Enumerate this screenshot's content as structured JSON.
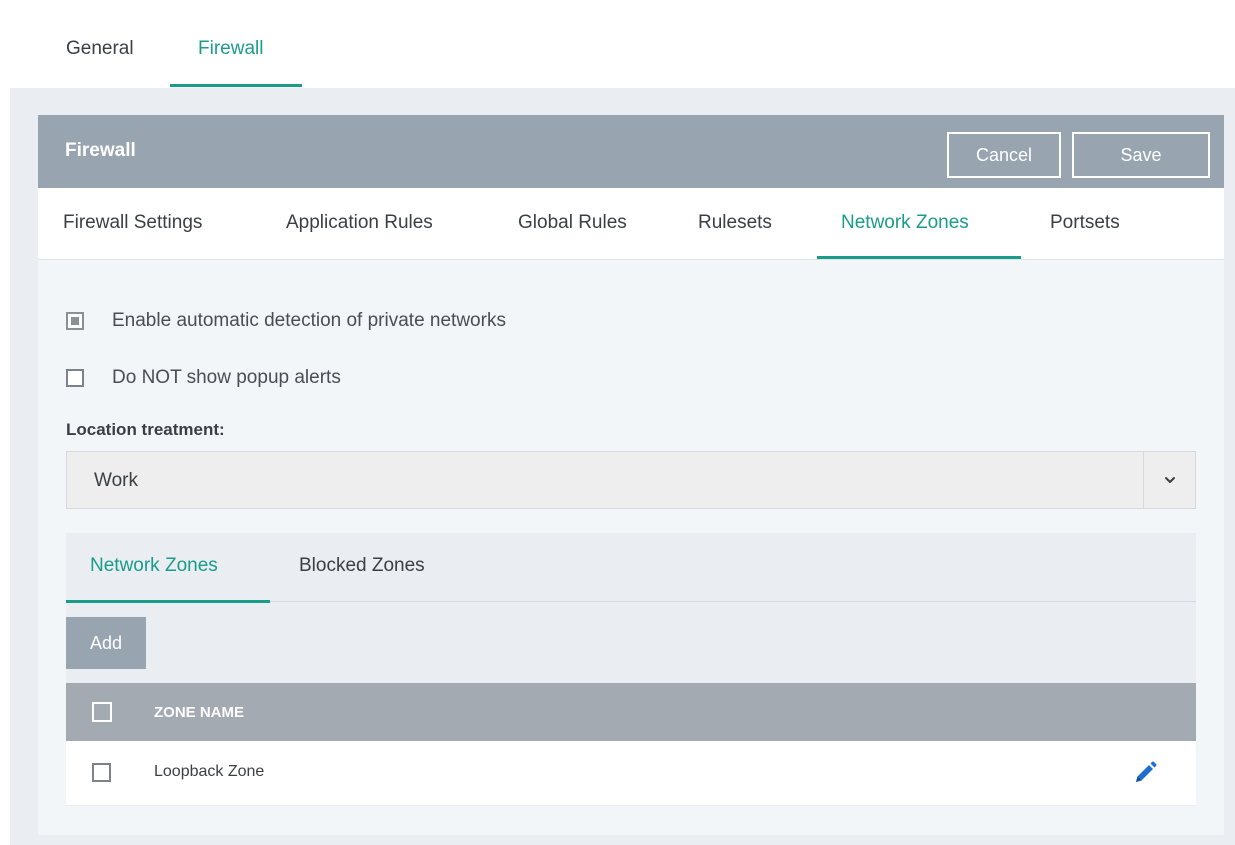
{
  "top_tabs": [
    {
      "label": "General",
      "active": false
    },
    {
      "label": "Firewall",
      "active": true
    }
  ],
  "panel": {
    "title": "Firewall",
    "cancel_label": "Cancel",
    "save_label": "Save"
  },
  "sub_tabs": [
    {
      "label": "Firewall Settings",
      "active": false
    },
    {
      "label": "Application Rules",
      "active": false
    },
    {
      "label": "Global Rules",
      "active": false
    },
    {
      "label": "Rulesets",
      "active": false
    },
    {
      "label": "Network Zones",
      "active": true
    },
    {
      "label": "Portsets",
      "active": false
    }
  ],
  "options": {
    "auto_detect": {
      "label": "Enable automatic detection of private networks",
      "checked": true
    },
    "no_popup": {
      "label": "Do NOT show popup alerts",
      "checked": false
    }
  },
  "location": {
    "label": "Location treatment:",
    "value": "Work",
    "arrow_icon": "chevron-down-icon"
  },
  "zones": {
    "tabs": [
      {
        "label": "Network Zones",
        "active": true
      },
      {
        "label": "Blocked Zones",
        "active": false
      }
    ],
    "add_label": "Add",
    "column_header": "ZONE NAME",
    "rows": [
      {
        "name": "Loopback Zone",
        "action_icon": "pencil-icon"
      }
    ]
  },
  "colors": {
    "accent": "#1a9c8a",
    "header_bg": "#98a5b1",
    "table_header_bg": "#a3aab2",
    "edit_icon": "#1f6fd1"
  }
}
